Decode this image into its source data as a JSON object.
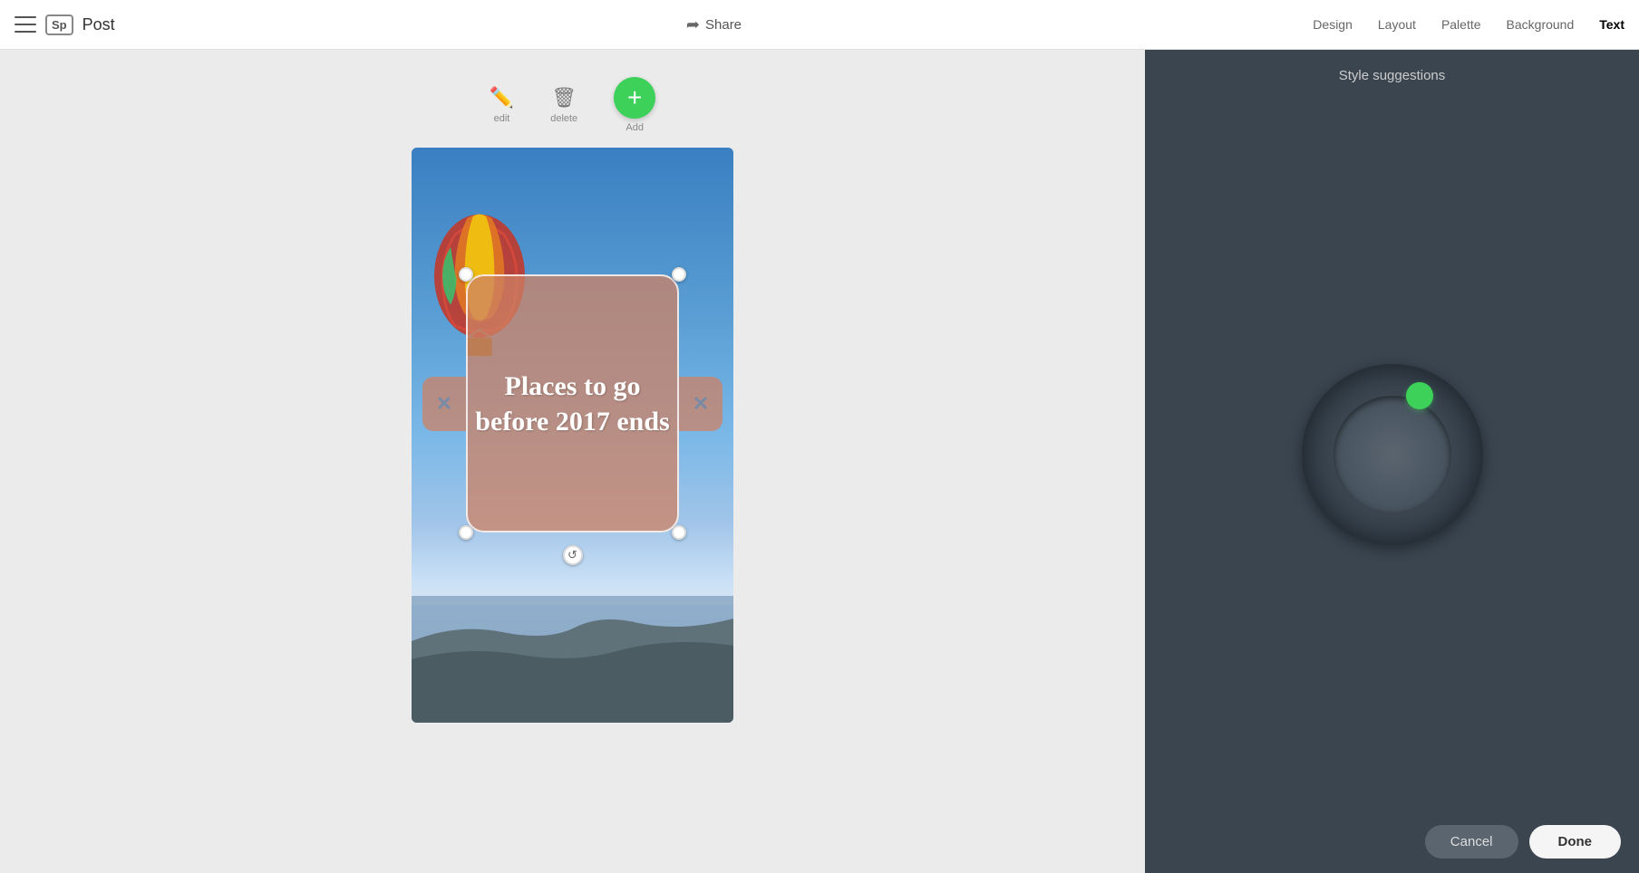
{
  "header": {
    "logo": "Sp",
    "title": "Post",
    "share_label": "Share",
    "nav": [
      {
        "id": "design",
        "label": "Design",
        "active": false
      },
      {
        "id": "layout",
        "label": "Layout",
        "active": false
      },
      {
        "id": "palette",
        "label": "Palette",
        "active": false
      },
      {
        "id": "background",
        "label": "Background",
        "active": false
      },
      {
        "id": "text",
        "label": "Text",
        "active": true
      }
    ]
  },
  "toolbar": {
    "edit_label": "edit",
    "delete_label": "delete",
    "add_label": "Add"
  },
  "canvas": {
    "post_text": "Places to go before 2017 ends"
  },
  "panel": {
    "title": "Style suggestions",
    "cancel_label": "Cancel",
    "done_label": "Done"
  }
}
